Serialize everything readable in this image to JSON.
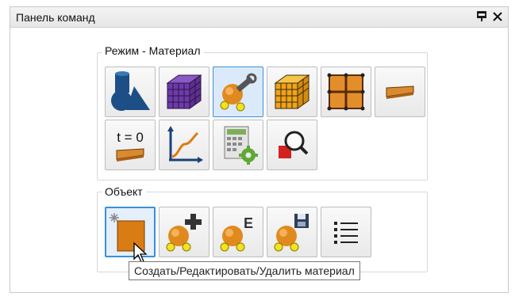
{
  "panel": {
    "title": "Панель команд",
    "controls": [
      "pin-icon",
      "close-icon"
    ]
  },
  "mode_group": {
    "label": "Режим - Материал",
    "buttons": [
      {
        "icon": "geometry-shapes-icon",
        "selected": false
      },
      {
        "icon": "purple-mesh-cube-icon",
        "selected": false
      },
      {
        "icon": "material-edit-tools-icon",
        "selected": true
      },
      {
        "icon": "yellow-mesh-cube-icon",
        "selected": false
      },
      {
        "icon": "grid-panel-icon",
        "selected": false
      },
      {
        "icon": "beam-strip-icon",
        "selected": false
      },
      {
        "icon": "initial-time-icon",
        "text": "t = 0",
        "selected": false
      },
      {
        "icon": "graph-curve-icon",
        "selected": false
      },
      {
        "icon": "calculator-gear-icon",
        "selected": false
      },
      {
        "icon": "zoom-material-icon",
        "selected": false
      }
    ]
  },
  "object_group": {
    "label": "Объект",
    "buttons": [
      {
        "icon": "create-material-icon",
        "selected": true
      },
      {
        "icon": "add-material-icon",
        "selected": false
      },
      {
        "icon": "edit-material-icon",
        "text": "E",
        "selected": false
      },
      {
        "icon": "save-material-icon",
        "selected": false
      },
      {
        "icon": "list-icon",
        "selected": false
      }
    ]
  },
  "tooltip": {
    "text": "Создать/Редактировать/Удалить материал"
  },
  "colors": {
    "accent": "#3c8fd8",
    "orange": "#e08a1e",
    "blue_shape": "#1d4f86"
  }
}
